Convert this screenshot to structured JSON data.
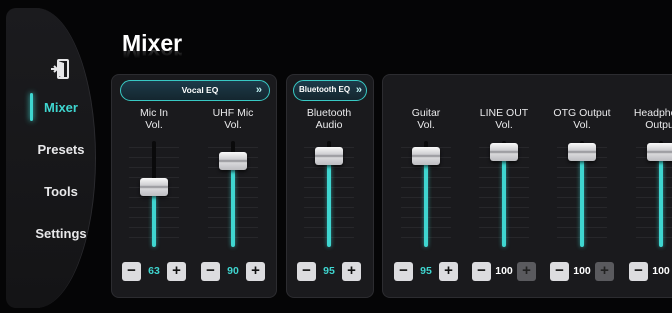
{
  "sidebar": {
    "items": [
      {
        "label": "Mixer",
        "active": true
      },
      {
        "label": "Presets",
        "active": false
      },
      {
        "label": "Tools",
        "active": false
      },
      {
        "label": "Settings",
        "active": false
      }
    ]
  },
  "page": {
    "title": "Mixer"
  },
  "colors": {
    "accent": "#3fd6d0",
    "panel": "#1a1a1d",
    "background": "#050506"
  },
  "eq_buttons": {
    "vocal": "Vocal EQ",
    "bluetooth": "Bluetooth EQ",
    "chevron": "»"
  },
  "channels": [
    {
      "label1": "Mic In",
      "label2": "Vol.",
      "value": "63",
      "level": 0.63,
      "plus_enabled": true
    },
    {
      "label1": "UHF Mic",
      "label2": "Vol.",
      "value": "90",
      "level": 0.9,
      "plus_enabled": true
    },
    {
      "label1": "Bluetooth",
      "label2": "Audio",
      "value": "95",
      "level": 0.95,
      "plus_enabled": true
    },
    {
      "label1": "Guitar",
      "label2": "Vol.",
      "value": "95",
      "level": 0.95,
      "plus_enabled": true
    },
    {
      "label1": "LINE OUT",
      "label2": "Vol.",
      "value": "100",
      "level": 1.0,
      "plus_enabled": false
    },
    {
      "label1": "OTG Output",
      "label2": "Vol.",
      "value": "100",
      "level": 1.0,
      "plus_enabled": false
    },
    {
      "label1": "Headphone",
      "label2": "Output",
      "value": "100",
      "level": 1.0,
      "plus_enabled": false
    }
  ],
  "stepper": {
    "minus": "−",
    "plus": "+"
  }
}
